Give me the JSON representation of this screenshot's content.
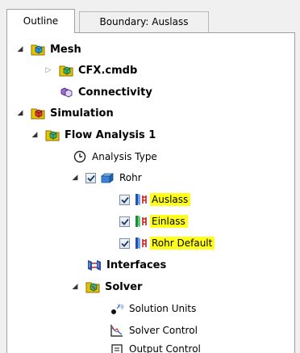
{
  "tabs": [
    {
      "label": "Outline",
      "active": true
    },
    {
      "label": "Boundary: Auslass",
      "active": false
    }
  ],
  "tree": {
    "mesh": {
      "label": "Mesh",
      "children": {
        "cfx": "CFX.cmdb",
        "connectivity": "Connectivity"
      }
    },
    "simulation": {
      "label": "Simulation",
      "flow": {
        "label": "Flow Analysis 1",
        "analysis_type": "Analysis Type",
        "rohr": {
          "label": "Rohr",
          "boundaries": [
            "Auslass",
            "Einlass",
            "Rohr Default"
          ]
        },
        "interfaces": "Interfaces",
        "solver": {
          "label": "Solver",
          "items": [
            "Solution Units",
            "Solver Control",
            "Output Control"
          ]
        }
      }
    }
  },
  "colors": {
    "highlight": "#ffff1a",
    "folder": "#c8a000",
    "cube": "#2a9fd6",
    "tab_border": "#a0a0a0"
  },
  "icons": {
    "mesh": "mesh-folder-icon",
    "cfx": "mesh-file-icon",
    "connectivity": "connectivity-icon",
    "simulation": "simulation-folder-icon",
    "flow": "flow-analysis-icon",
    "analysis_type": "clock-icon",
    "rohr": "domain-icon",
    "boundary": "boundary-icon",
    "interfaces": "interfaces-icon",
    "solver": "solver-folder-icon",
    "solution_units": "units-icon",
    "solver_control": "convergence-icon",
    "output_control": "output-icon"
  }
}
